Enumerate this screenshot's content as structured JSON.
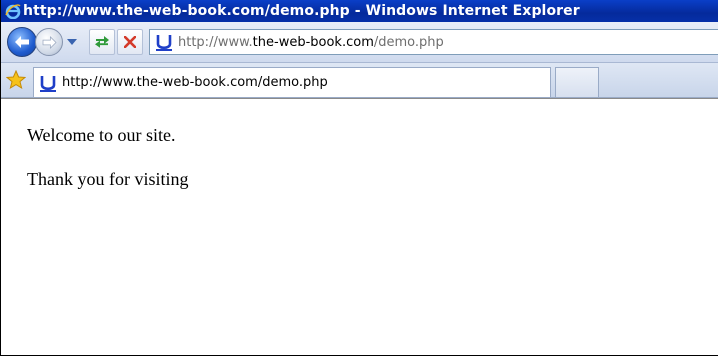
{
  "window": {
    "title": "http://www.the-web-book.com/demo.php - Windows Internet Explorer"
  },
  "navbar": {
    "back_icon": "back-arrow-icon",
    "forward_icon": "forward-arrow-icon",
    "refresh_icon": "refresh-icon",
    "stop_icon": "stop-icon",
    "address": {
      "prefix": "http://www.",
      "domain": "the-web-book.com",
      "suffix": "/demo.php"
    }
  },
  "tabs": {
    "favorites_icon": "favorites-star-icon",
    "active_tab_title": "http://www.the-web-book.com/demo.php"
  },
  "page": {
    "line1": "Welcome to our site.",
    "line2": "Thank you for visiting"
  },
  "colors": {
    "titlebar": "#0a3fc8",
    "toolbar": "#dfe7f4",
    "back_button": "#1f5ccf",
    "stop_red": "#d43a2a",
    "refresh_green": "#2f9a3a"
  }
}
